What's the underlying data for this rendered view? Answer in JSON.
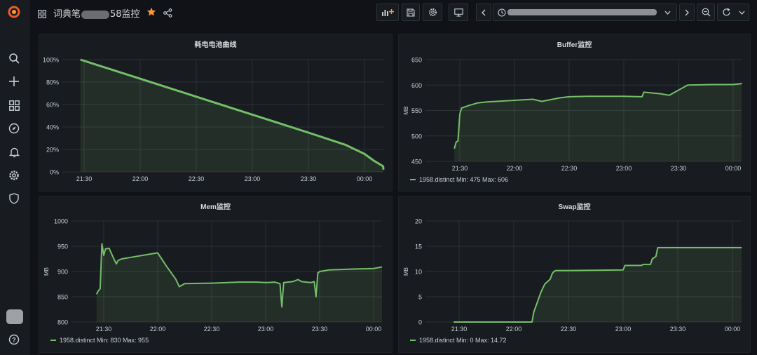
{
  "header": {
    "title_prefix": "词典笔",
    "title_suffix": "58监控",
    "time_range": ""
  },
  "sidebar": {
    "items": [
      {
        "icon": "search-icon"
      },
      {
        "icon": "plus-icon"
      },
      {
        "icon": "dashboards-icon"
      },
      {
        "icon": "compass-icon"
      },
      {
        "icon": "bell-icon"
      },
      {
        "icon": "gear-icon"
      },
      {
        "icon": "shield-icon"
      },
      {
        "icon": "avatar"
      },
      {
        "icon": "help-icon"
      }
    ]
  },
  "colors": {
    "series": "#73bf69",
    "background": "#111217",
    "panel": "#181b1f",
    "grid": "#2c3235",
    "star": "#ff9830"
  },
  "chart_data": [
    {
      "id": "battery",
      "type": "area",
      "title": "耗电电池曲线",
      "ylabel": "",
      "ylim": [
        0,
        100
      ],
      "y_ticks": [
        "0%",
        "20%",
        "40%",
        "60%",
        "80%",
        "100%"
      ],
      "x_ticks": [
        "21:30",
        "22:00",
        "22:30",
        "23:00",
        "23:30",
        "00:00"
      ],
      "series": [
        {
          "name": "",
          "x": [
            "21:28",
            "21:45",
            "22:00",
            "22:30",
            "23:00",
            "23:30",
            "23:50",
            "00:00",
            "00:05",
            "00:10",
            "00:15"
          ],
          "values": [
            100,
            91,
            83,
            67,
            51,
            35,
            24,
            16,
            10,
            5,
            2
          ]
        }
      ]
    },
    {
      "id": "buffer",
      "type": "area",
      "title": "Buffer监控",
      "ylabel": "MB",
      "ylim": [
        450,
        650
      ],
      "y_ticks": [
        "450",
        "500",
        "550",
        "600",
        "650"
      ],
      "x_ticks": [
        "21:30",
        "22:00",
        "22:30",
        "23:00",
        "23:30",
        "00:00"
      ],
      "legend": {
        "series": "1958.distinct",
        "min_label": "Min:",
        "min": "475",
        "max_label": "Max:",
        "max": "606"
      },
      "series": [
        {
          "name": "1958.distinct",
          "x": [
            "21:27",
            "21:28",
            "21:29",
            "21:30",
            "21:31",
            "21:35",
            "21:38",
            "21:40",
            "21:45",
            "22:00",
            "22:10",
            "22:15",
            "22:25",
            "22:30",
            "22:40",
            "23:00",
            "23:10",
            "23:11",
            "23:20",
            "23:25",
            "23:26",
            "23:30",
            "23:35",
            "23:50",
            "00:00",
            "00:10",
            "00:15"
          ],
          "values": [
            475,
            488,
            490,
            543,
            555,
            560,
            563,
            565,
            567,
            570,
            572,
            568,
            575,
            577,
            578,
            578,
            577,
            586,
            583,
            580,
            582,
            590,
            600,
            601,
            601,
            603,
            602
          ]
        }
      ]
    },
    {
      "id": "mem",
      "type": "area",
      "title": "Mem监控",
      "ylabel": "MB",
      "ylim": [
        800,
        1000
      ],
      "y_ticks": [
        "800",
        "850",
        "900",
        "950",
        "1000"
      ],
      "x_ticks": [
        "21:30",
        "22:00",
        "22:30",
        "23:00",
        "23:30",
        "00:00"
      ],
      "legend": {
        "series": "1958.distinct",
        "min_label": "Min:",
        "min": "830",
        "max_label": "Max:",
        "max": "955"
      },
      "series": [
        {
          "name": "1958.distinct",
          "x": [
            "21:26",
            "21:27",
            "21:28",
            "21:29",
            "21:30",
            "21:31",
            "21:33",
            "21:35",
            "21:37",
            "21:38",
            "21:40",
            "21:45",
            "21:55",
            "22:00",
            "22:05",
            "22:10",
            "22:12",
            "22:15",
            "22:30",
            "22:45",
            "22:55",
            "23:00",
            "23:05",
            "23:08",
            "23:09",
            "23:10",
            "23:15",
            "23:18",
            "23:20",
            "23:25",
            "23:27",
            "23:28",
            "23:29",
            "23:30",
            "23:35",
            "23:50",
            "00:00",
            "00:10",
            "00:15"
          ],
          "values": [
            855,
            862,
            866,
            955,
            932,
            945,
            946,
            930,
            915,
            922,
            925,
            928,
            934,
            937,
            910,
            885,
            870,
            876,
            877,
            879,
            879,
            878,
            879,
            876,
            830,
            878,
            880,
            884,
            880,
            878,
            880,
            850,
            897,
            900,
            903,
            905,
            906,
            909,
            909
          ]
        }
      ]
    },
    {
      "id": "swap",
      "type": "area",
      "title": "Swap监控",
      "ylabel": "MB",
      "ylim": [
        0,
        20
      ],
      "y_ticks": [
        "0",
        "5",
        "10",
        "15",
        "20"
      ],
      "x_ticks": [
        "21:30",
        "22:00",
        "22:30",
        "23:00",
        "23:30",
        "00:00"
      ],
      "legend": {
        "series": "1958.distinct",
        "min_label": "Min:",
        "min": "0",
        "max_label": "Max:",
        "max": "14.72"
      },
      "series": [
        {
          "name": "1958.distinct",
          "x": [
            "21:27",
            "22:10",
            "22:11",
            "22:13",
            "22:15",
            "22:17",
            "22:20",
            "22:21",
            "22:22",
            "22:23",
            "22:30",
            "23:00",
            "23:01",
            "23:10",
            "23:11",
            "23:15",
            "23:16",
            "23:18",
            "23:19",
            "23:40",
            "00:00",
            "00:15"
          ],
          "values": [
            0,
            0,
            2,
            4,
            6,
            7.5,
            8.5,
            9.5,
            10,
            10.2,
            10.2,
            10.3,
            11.2,
            11.2,
            11.4,
            11.4,
            12.5,
            13,
            14.72,
            14.72,
            14.72,
            14.72
          ]
        }
      ]
    }
  ]
}
